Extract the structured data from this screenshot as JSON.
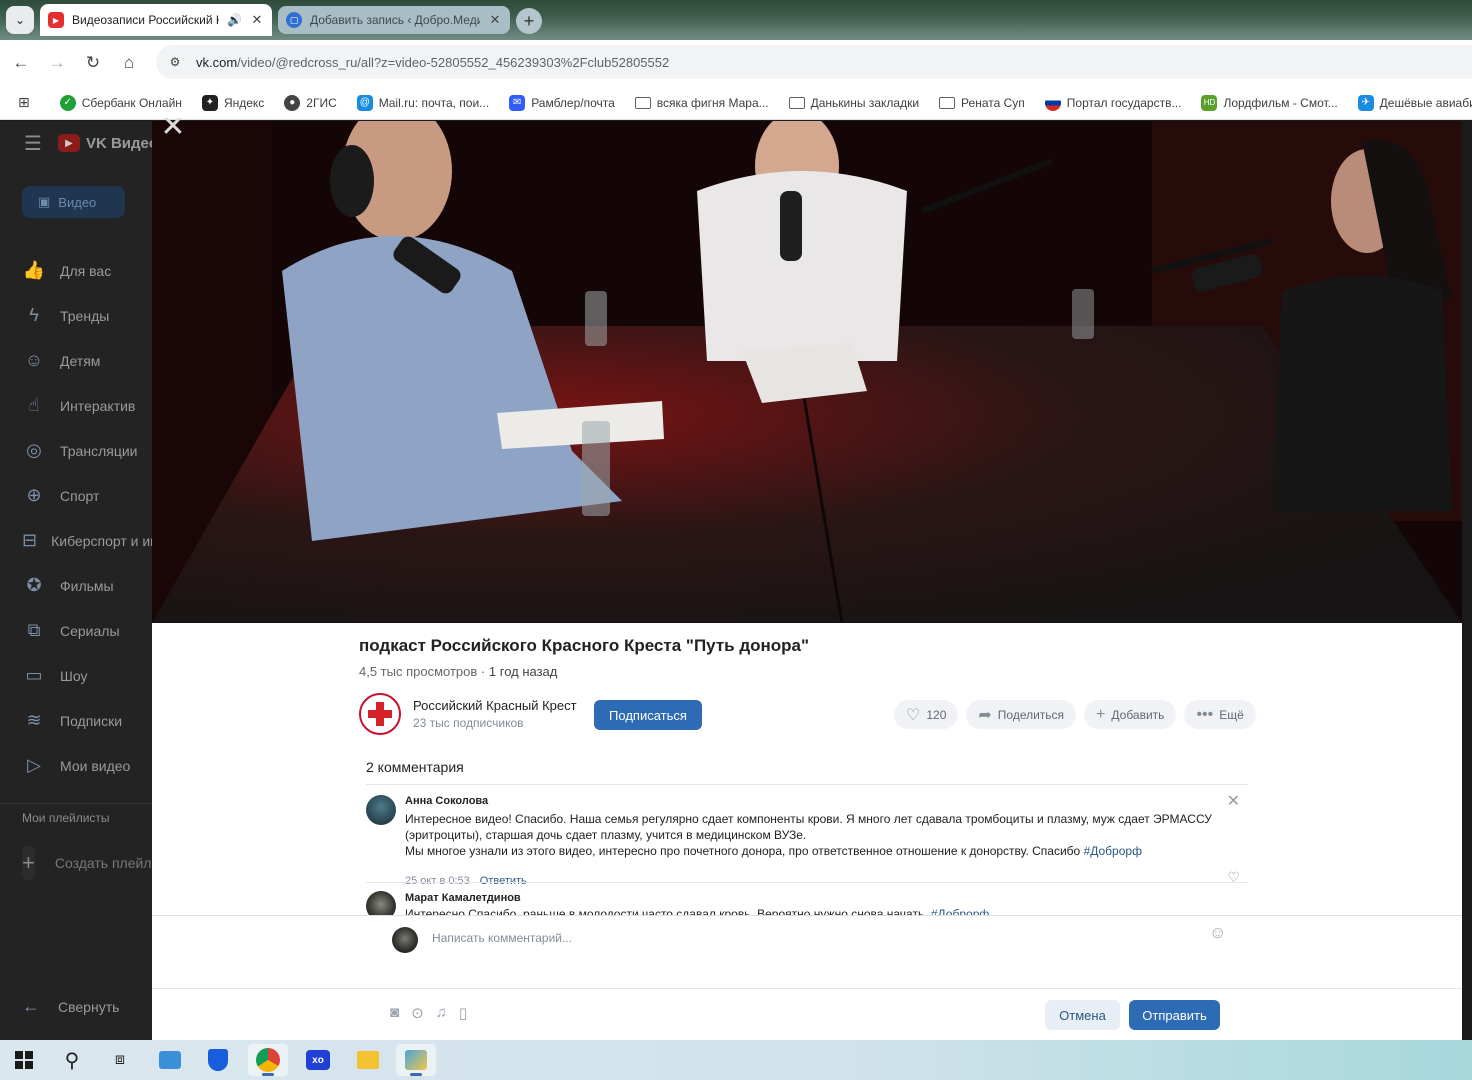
{
  "browser": {
    "tabs": [
      {
        "title": "Видеозаписи Российский Красный Крест",
        "active": true
      },
      {
        "title": "Добавить запись ‹ Добро.Медиа",
        "active": false
      }
    ],
    "url_host": "vk.com",
    "url_path": "/video/@redcross_ru/all?z=video-52805552_456239303%2Fclub52805552",
    "bookmarks": [
      "Сбербанк Онлайн",
      "Яндекс",
      "2ГИС",
      "Mail.ru: почта, пои...",
      "Рамблер/почта",
      "всяка фигня Мара...",
      "Данькины закладки",
      "Рената Суп",
      "Портал государств...",
      "Лордфильм - Смот...",
      "Дешёвые авиабиле..."
    ]
  },
  "vk": {
    "logo_text": "VK Видео",
    "video_tab": "Видео",
    "nav": [
      {
        "label": "Для вас",
        "icon": "thumbs-up-icon"
      },
      {
        "label": "Тренды",
        "icon": "lightning-icon"
      },
      {
        "label": "Детям",
        "icon": "kids-icon"
      },
      {
        "label": "Интерактив",
        "icon": "hand-pointer-icon"
      },
      {
        "label": "Трансляции",
        "icon": "broadcast-icon"
      },
      {
        "label": "Спорт",
        "icon": "ball-icon"
      },
      {
        "label": "Киберспорт и игры",
        "icon": "gamepad-icon"
      },
      {
        "label": "Фильмы",
        "icon": "film-reel-icon"
      },
      {
        "label": "Сериалы",
        "icon": "series-icon"
      },
      {
        "label": "Шоу",
        "icon": "tv-icon"
      },
      {
        "label": "Подписки",
        "icon": "subscriptions-icon"
      },
      {
        "label": "Мои видео",
        "icon": "my-videos-icon"
      }
    ],
    "playlists_label": "Мои плейлисты",
    "create_playlist": "Создать плейлист",
    "collapse": "Свернуть"
  },
  "video": {
    "title": "подкаст Российского Красного Креста \"Путь донора\"",
    "views": "4,5 тыс просмотров",
    "separator": "·",
    "age": "1 год назад",
    "owner_name": "Российский Красный Крест",
    "owner_subs": "23 тыс подписчиков",
    "subscribe": "Подписаться",
    "likes": "120",
    "share": "Поделиться",
    "add": "Добавить",
    "more": "Ещё"
  },
  "comments": {
    "count_label": "2 комментария",
    "items": [
      {
        "author": "Анна Соколова",
        "text_1": "Интересное видео! Спасибо. Наша семья регулярно сдает компоненты крови. Я много лет сдавала тромбоциты и плазму, муж сдает ЭРМАССУ (эритроциты), старшая дочь сдает плазму, учится в медицинском ВУЗе.",
        "text_2": "Мы многое узнали из этого видео, интересно про почетного донора, про ответственное отношение к донорству. Спасибо ",
        "tag": "#Доброрф",
        "date": "25 окт в 0:53",
        "reply": "Ответить"
      },
      {
        "author": "Марат Камалетдинов",
        "text": "Интересно Спасибо, раньше в молодости часто сдавал кровь. Вероятно нужно снова начать. ",
        "tag": "#Доброрф"
      }
    ],
    "placeholder": "Написать комментарий...",
    "cancel": "Отмена",
    "send": "Отправить"
  }
}
